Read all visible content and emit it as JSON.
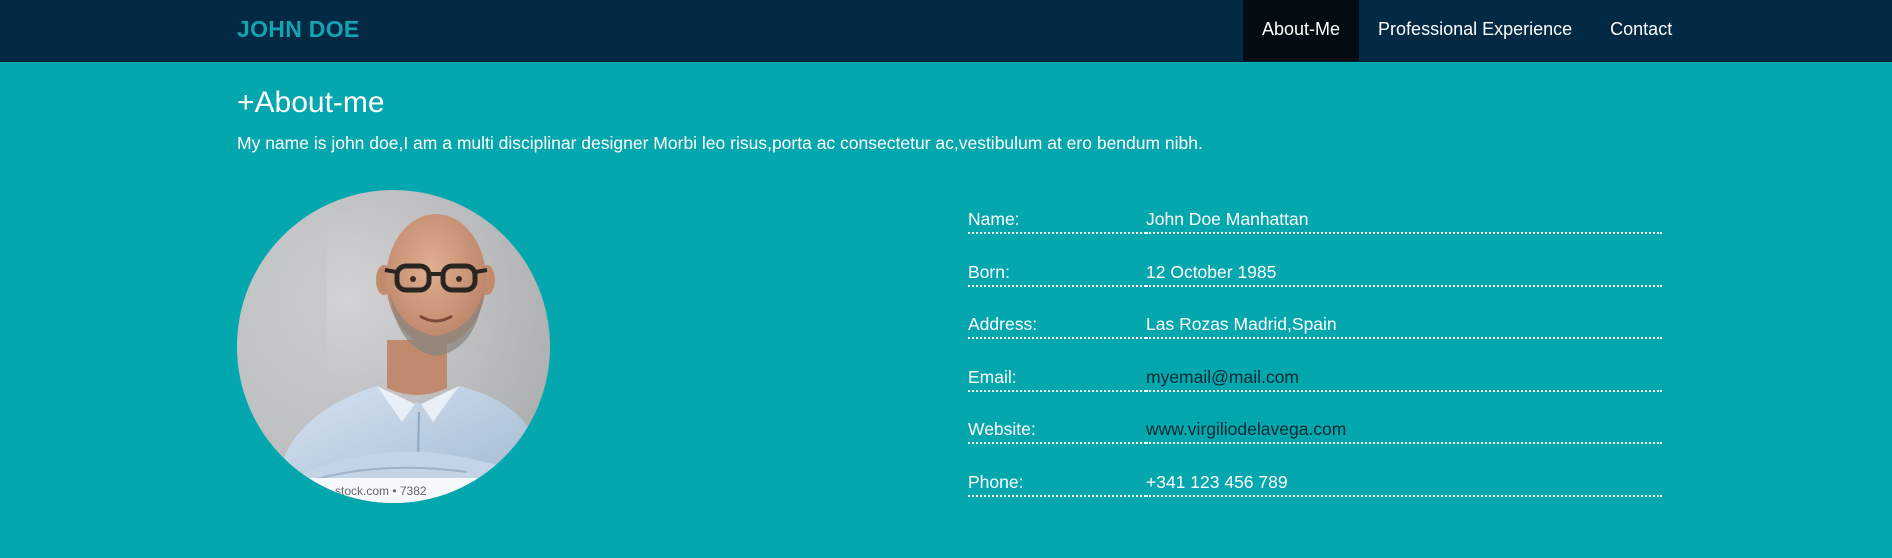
{
  "header": {
    "brand": "JOHN DOE",
    "nav": [
      {
        "label": "About-Me",
        "active": true
      },
      {
        "label": "Professional Experience",
        "active": false
      },
      {
        "label": "Contact",
        "active": false
      }
    ]
  },
  "about": {
    "title": "+About-me",
    "intro": "My name is john doe,I am a multi disciplinar designer Morbi leo risus,porta ac consectetur ac,vestibulum at ero bendum nibh.",
    "photo_watermark": "stock.com • 7382",
    "details": [
      {
        "label": "Name:",
        "value": "John Doe Manhattan"
      },
      {
        "label": "Born:",
        "value": "12 October 1985"
      },
      {
        "label": "Address:",
        "value": "Las Rozas Madrid,Spain"
      },
      {
        "label": "Email:",
        "value": "myemail@mail.com"
      },
      {
        "label": "Website:",
        "value": "www.virgiliodelavega.com"
      },
      {
        "label": "Phone:",
        "value": "+341 123 456 789"
      }
    ]
  },
  "colors": {
    "background": "#04a7ae",
    "navbar": "#032945",
    "nav_active": "#020c12",
    "brand": "#14a3b0"
  }
}
